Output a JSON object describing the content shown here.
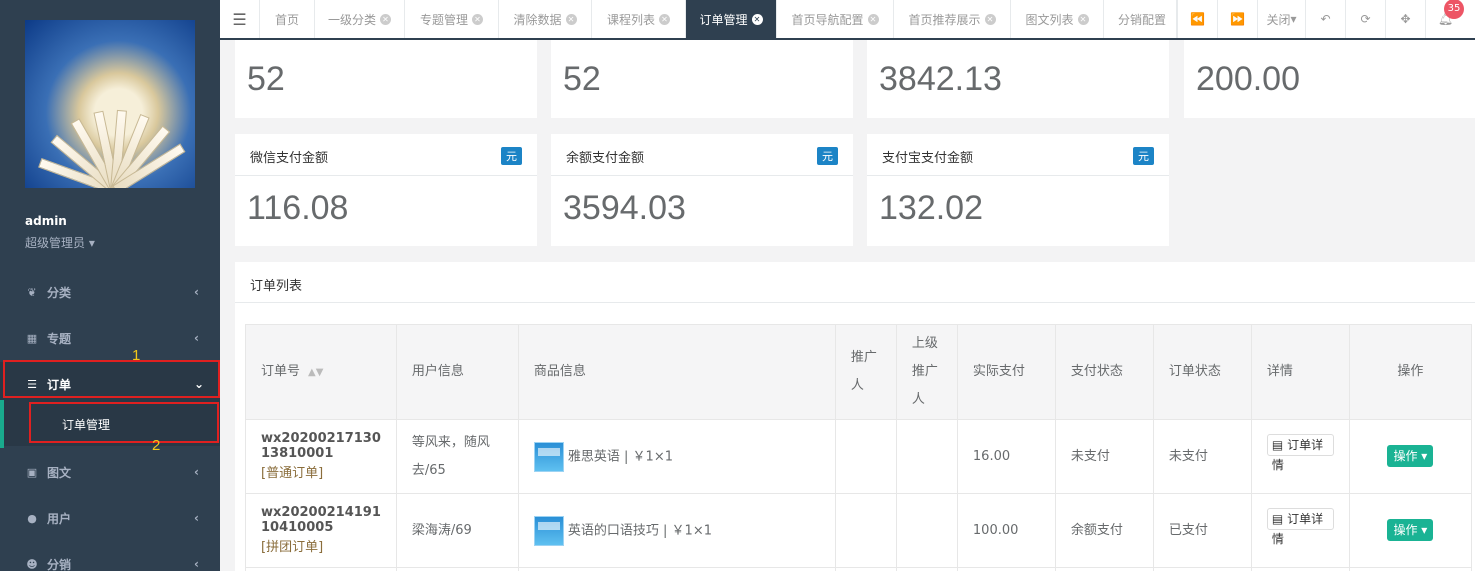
{
  "sidebar": {
    "user_name": "admin",
    "user_role": "超级管理员",
    "items": [
      {
        "label": "分类",
        "icon": "leaf-icon"
      },
      {
        "label": "专题",
        "icon": "grid-icon"
      },
      {
        "label": "订单",
        "icon": "table-icon"
      },
      {
        "label": "图文",
        "icon": "image-icon"
      },
      {
        "label": "用户",
        "icon": "user-icon"
      },
      {
        "label": "分销",
        "icon": "users-icon"
      }
    ],
    "sub_item": "订单管理",
    "annotations": [
      "1",
      "2"
    ]
  },
  "tabs": [
    {
      "label": "首页",
      "closable": false
    },
    {
      "label": "一级分类",
      "closable": true
    },
    {
      "label": "专题管理",
      "closable": true
    },
    {
      "label": "清除数据",
      "closable": true
    },
    {
      "label": "课程列表",
      "closable": true
    },
    {
      "label": "订单管理",
      "closable": true,
      "active": true
    },
    {
      "label": "首页导航配置",
      "closable": true
    },
    {
      "label": "首页推荐展示",
      "closable": true
    },
    {
      "label": "图文列表",
      "closable": true
    },
    {
      "label": "分销配置",
      "closable": false
    }
  ],
  "toolbar": {
    "close_label": "关闭",
    "notification_count": "35"
  },
  "stats_top": [
    "52",
    "52",
    "3842.13",
    "200.00"
  ],
  "stats": [
    {
      "title": "微信支付金额",
      "unit": "元",
      "value": "116.08"
    },
    {
      "title": "余额支付金额",
      "unit": "元",
      "value": "3594.03"
    },
    {
      "title": "支付宝支付金额",
      "unit": "元",
      "value": "132.02"
    }
  ],
  "order_list": {
    "title": "订单列表",
    "columns": [
      "订单号",
      "用户信息",
      "商品信息",
      "推广人",
      "上级推广人",
      "实际支付",
      "支付状态",
      "订单状态",
      "详情",
      "操作"
    ],
    "rows": [
      {
        "order_no": "wx2020021713013810001",
        "order_no_l1": "wx20200217130",
        "order_no_l2": "13810001",
        "type": "[普通订单]",
        "user": "等风来，随风去/65",
        "product": "雅思英语 | ￥1×1",
        "promoter": "",
        "upper_promoter": "",
        "paid": "16.00",
        "pay_status": "未支付",
        "order_status": "未支付",
        "detail_btn": "订单详情",
        "op_btn": "操作"
      },
      {
        "order_no": "wx2020021419110410005",
        "order_no_l1": "wx20200214191",
        "order_no_l2": "10410005",
        "type": "[拼团订单]",
        "user": "梁海涛/69",
        "product": "英语的口语技巧 | ￥1×1",
        "promoter": "",
        "upper_promoter": "",
        "paid": "100.00",
        "pay_status": "余额支付",
        "order_status": "已支付",
        "detail_btn": "订单详情",
        "op_btn": "操作"
      }
    ]
  }
}
